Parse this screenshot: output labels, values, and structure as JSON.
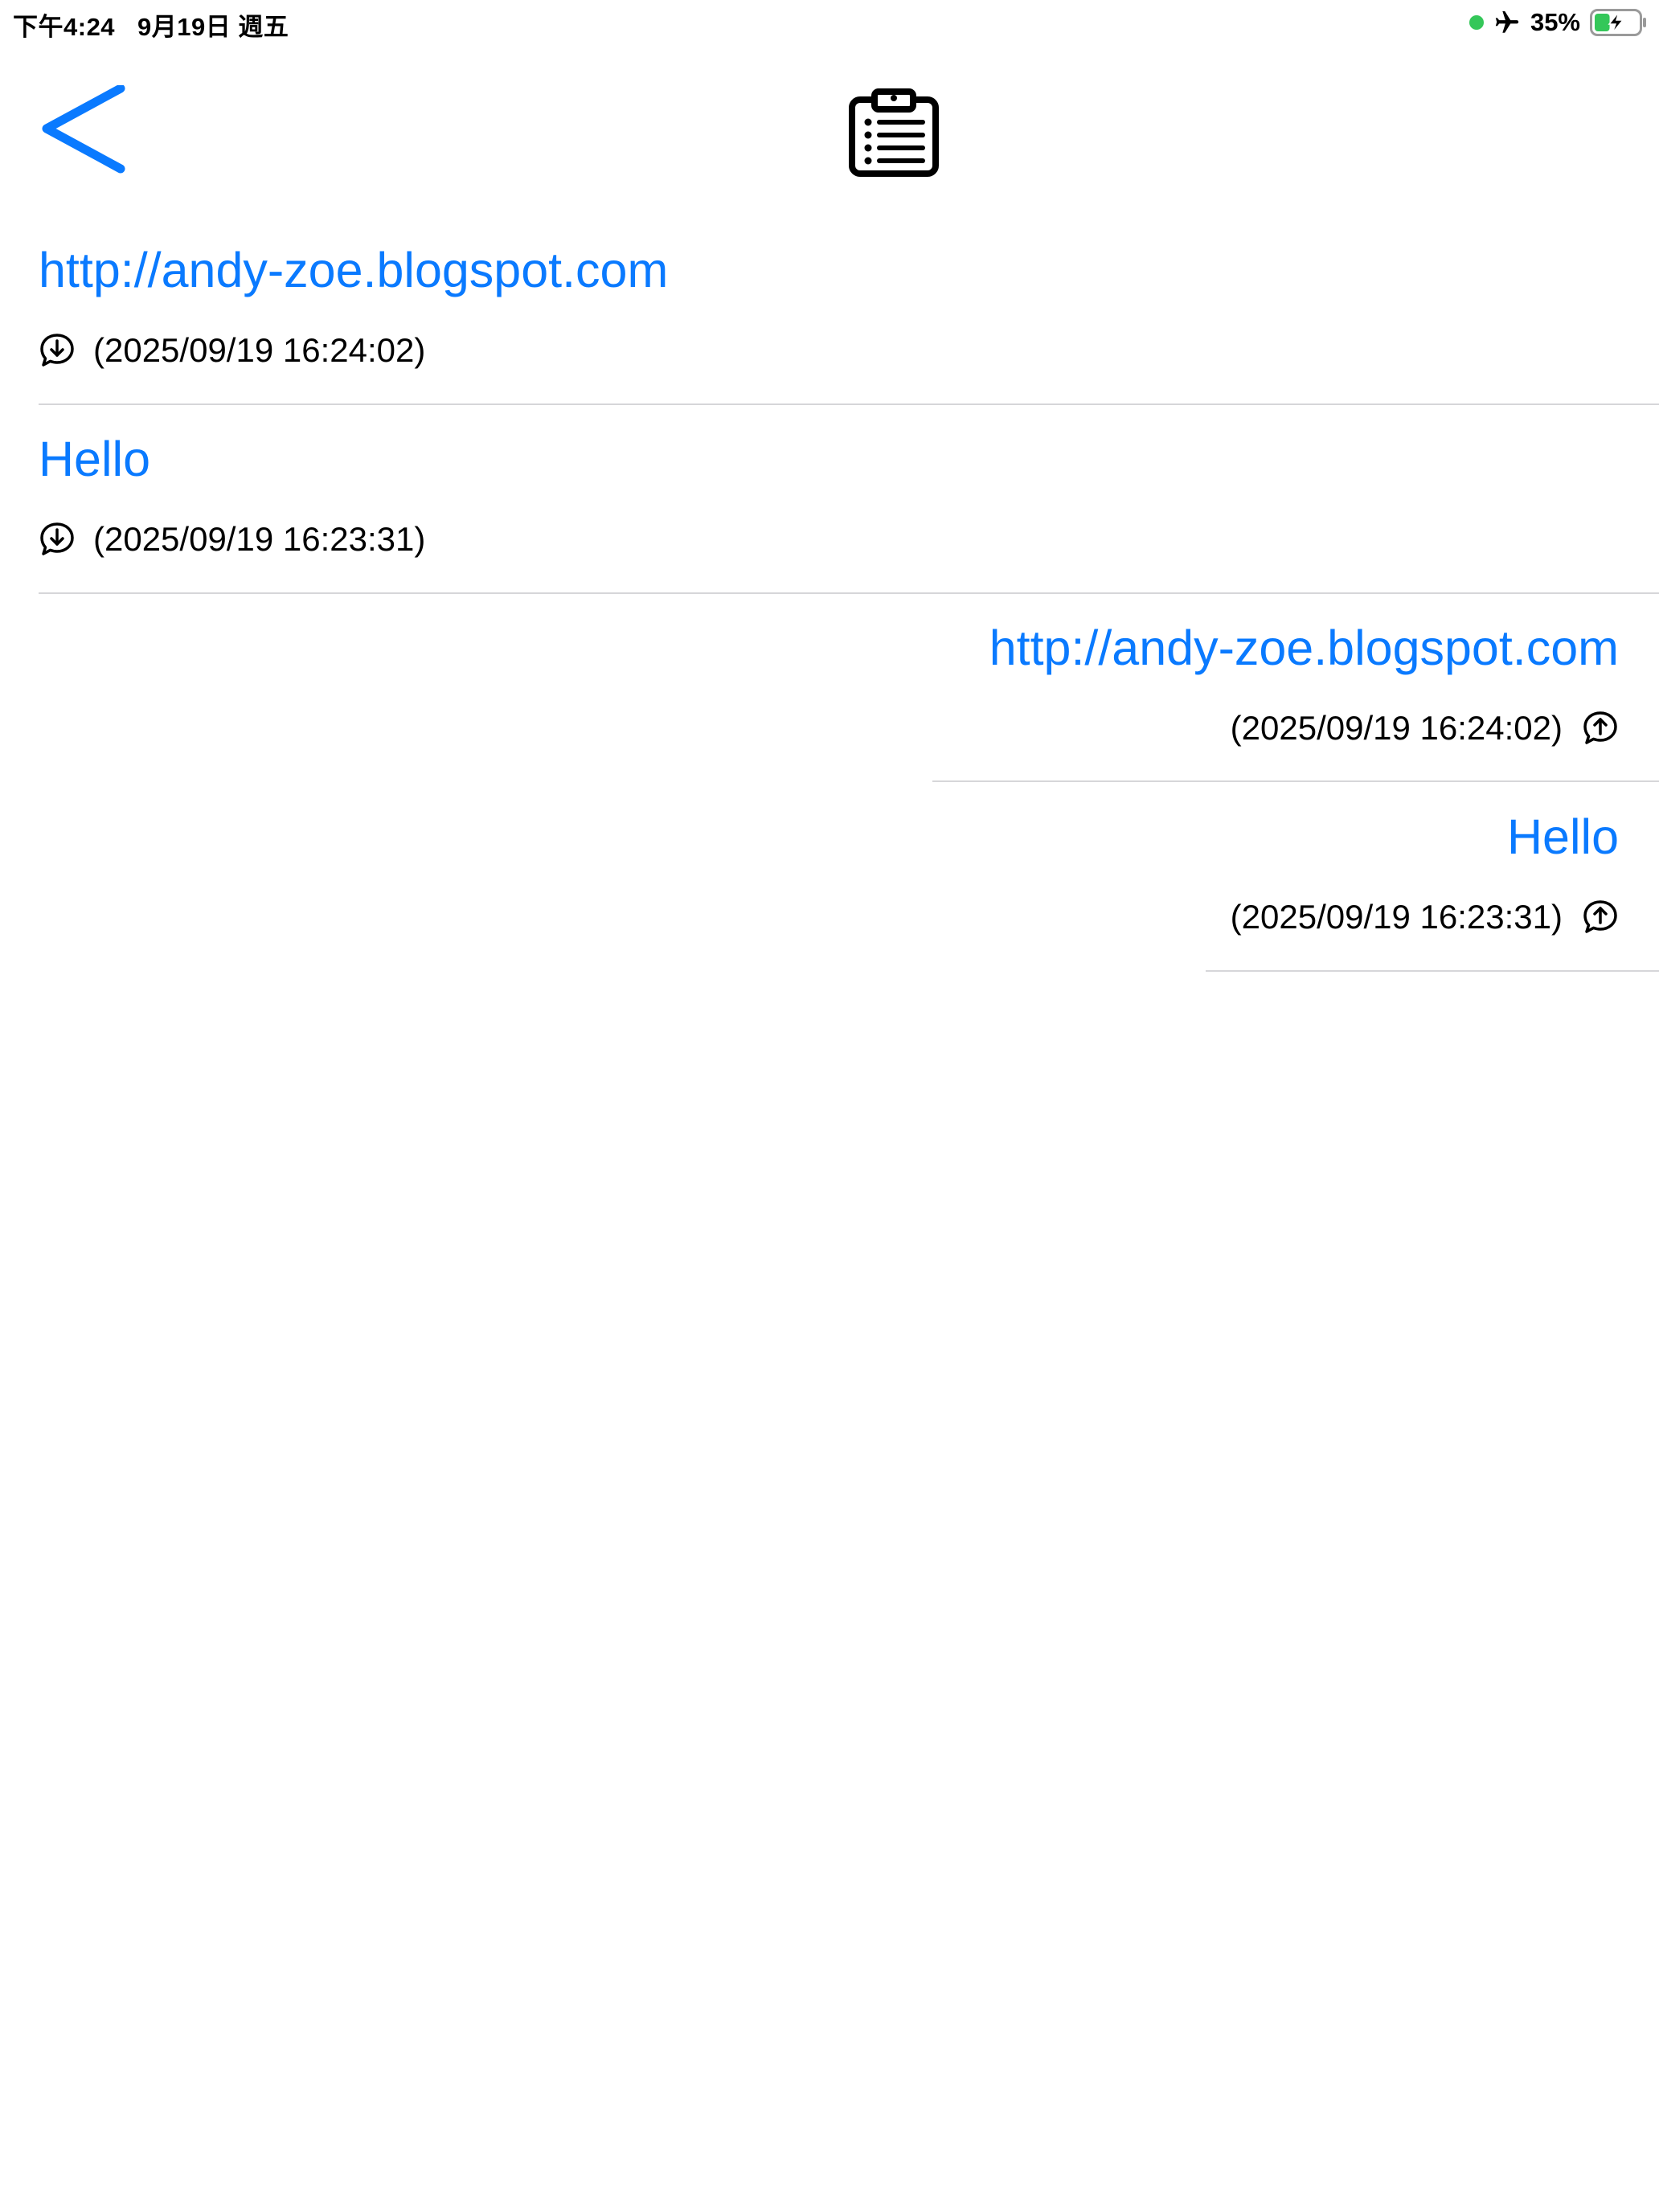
{
  "status_bar": {
    "time": "下午4:24",
    "date": "9月19日 週五",
    "battery_percent": "35%",
    "battery_level": 0.35,
    "indicator_color": "#34c759",
    "icons": [
      "green-dot-icon",
      "airplane-icon",
      "battery-charging-icon"
    ]
  },
  "nav": {
    "back_icon": "chevron-left-icon",
    "title_icon": "clipboard-list-icon",
    "accent_color": "#0a7aff"
  },
  "messages": [
    {
      "direction": "received",
      "text": "http://andy-zoe.blogspot.com",
      "timestamp": "(2025/09/19 16:24:02)",
      "icon": "speech-bubble-down-arrow-icon"
    },
    {
      "direction": "received",
      "text": "Hello",
      "timestamp": "(2025/09/19 16:23:31)",
      "icon": "speech-bubble-down-arrow-icon"
    },
    {
      "direction": "sent",
      "text": "http://andy-zoe.blogspot.com",
      "timestamp": "(2025/09/19 16:24:02)",
      "icon": "speech-bubble-up-arrow-icon"
    },
    {
      "direction": "sent",
      "text": "Hello",
      "timestamp": "(2025/09/19 16:23:31)",
      "icon": "speech-bubble-up-arrow-icon"
    }
  ]
}
